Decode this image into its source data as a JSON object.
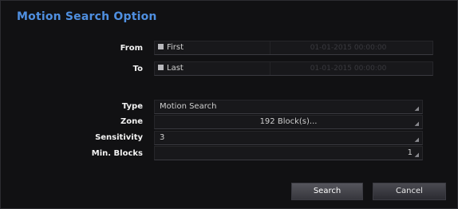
{
  "dialog": {
    "title": "Motion Search Option"
  },
  "from": {
    "label": "From",
    "option_label": "First",
    "datetime": "01-01-2015 00:00:00"
  },
  "to": {
    "label": "To",
    "option_label": "Last",
    "datetime": "01-01-2015 00:00:00"
  },
  "type": {
    "label": "Type",
    "value": "Motion Search"
  },
  "zone": {
    "label": "Zone",
    "value": "192 Block(s)..."
  },
  "sensitivity": {
    "label": "Sensitivity",
    "value": "3"
  },
  "min_blocks": {
    "label": "Min. Blocks",
    "value": "1"
  },
  "buttons": {
    "search": "Search",
    "cancel": "Cancel"
  },
  "colors": {
    "title": "#4f8fe0",
    "background": "#111113"
  }
}
